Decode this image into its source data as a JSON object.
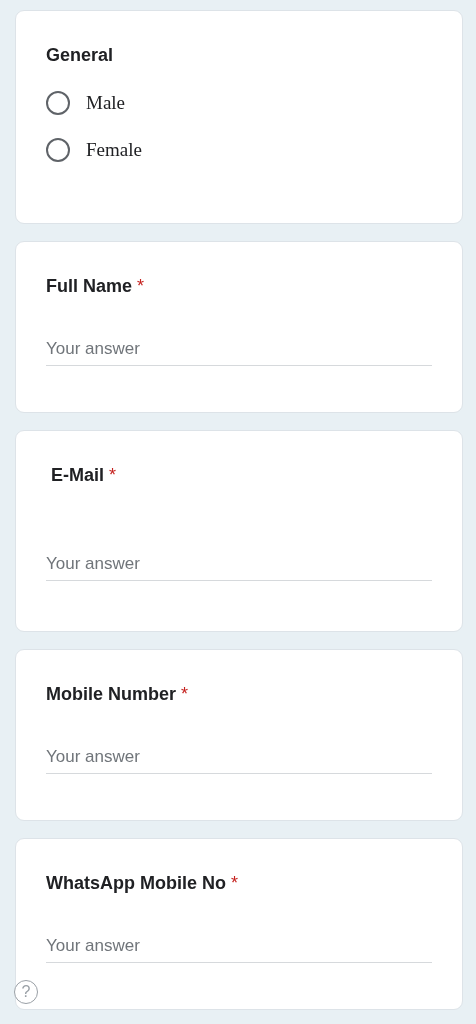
{
  "sections": [
    {
      "kind": "choice",
      "title": "General",
      "options": [
        {
          "label": "Male",
          "selected": false
        },
        {
          "label": "Female",
          "selected": false
        }
      ]
    },
    {
      "kind": "text",
      "title": "Full Name",
      "required_mark": "*",
      "placeholder": "Your answer"
    },
    {
      "kind": "text",
      "title": "E-Mail",
      "required_mark": "*",
      "placeholder": "Your answer"
    },
    {
      "kind": "text",
      "title": "Mobile Number",
      "required_mark": "*",
      "placeholder": "Your answer"
    },
    {
      "kind": "text",
      "title": "WhatsApp Mobile No",
      "required_mark": "*",
      "placeholder": "Your answer"
    }
  ],
  "help_button": {
    "label": "?"
  }
}
